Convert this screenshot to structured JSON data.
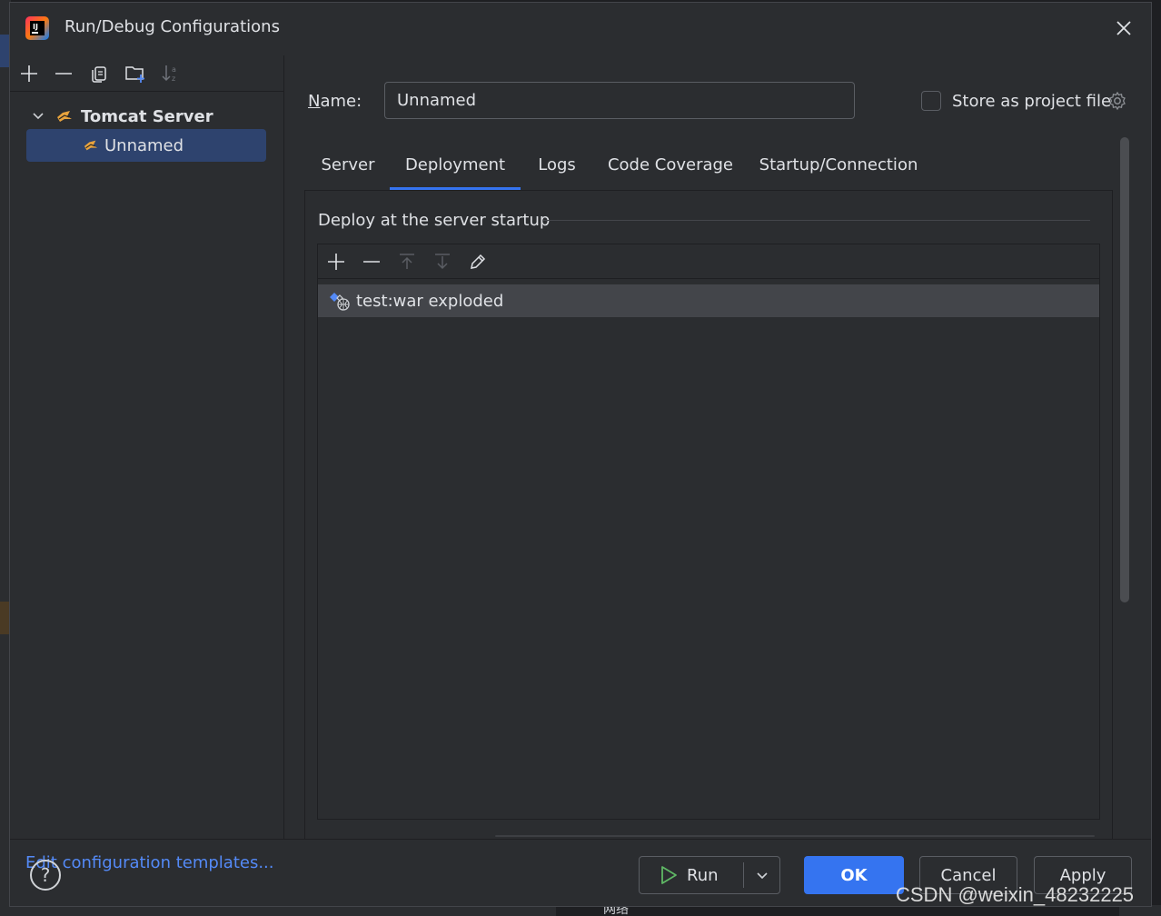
{
  "dialog": {
    "title": "Run/Debug Configurations"
  },
  "sidebar": {
    "tree": {
      "group_label": "Tomcat Server",
      "items": [
        {
          "label": "Unnamed"
        }
      ]
    },
    "edit_templates_link": "Edit configuration templates..."
  },
  "form": {
    "name_label": "Name:",
    "name_value": "Unnamed",
    "store_as_project_file_label": "Store as project file",
    "store_as_project_file_checked": false
  },
  "tabs": [
    {
      "label": "Server",
      "active": false
    },
    {
      "label": "Deployment",
      "active": true
    },
    {
      "label": "Logs",
      "active": false
    },
    {
      "label": "Code Coverage",
      "active": false
    },
    {
      "label": "Startup/Connection",
      "active": false
    }
  ],
  "deployment": {
    "section_title": "Deploy at the server startup",
    "artifacts": [
      {
        "label": "test:war exploded",
        "selected": true
      }
    ]
  },
  "footer": {
    "help_label": "?",
    "run_label": "Run",
    "ok_label": "OK",
    "cancel_label": "Cancel",
    "apply_label": "Apply"
  },
  "background": {
    "taskbar_text": "网络",
    "watermark": "CSDN @weixin_48232225"
  },
  "colors": {
    "accent": "#3574f0",
    "link": "#548af7",
    "selection": "#2e436e",
    "panel_bg": "#2b2d30"
  }
}
